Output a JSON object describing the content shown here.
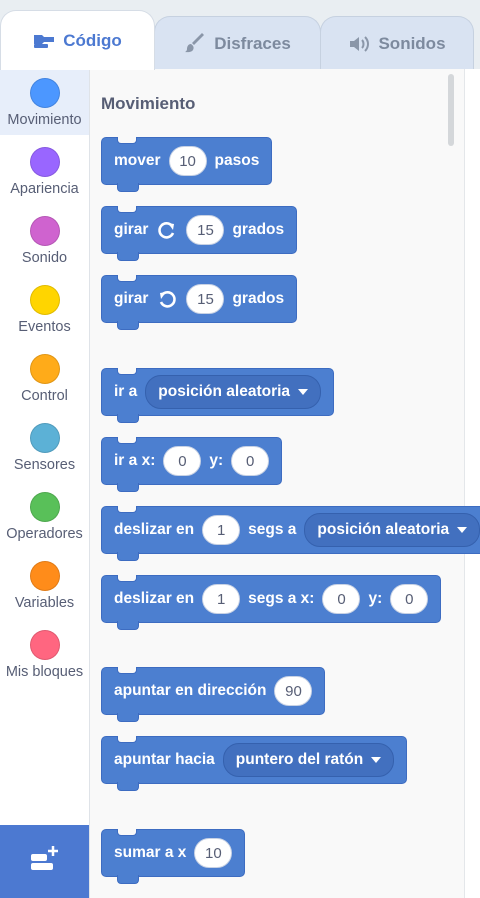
{
  "tabs": [
    {
      "label": "Código",
      "icon": "code-blocks-icon",
      "active": true
    },
    {
      "label": "Disfraces",
      "icon": "paintbrush-icon",
      "active": false
    },
    {
      "label": "Sonidos",
      "icon": "speaker-icon",
      "active": false
    }
  ],
  "categories": [
    {
      "label": "Movimiento",
      "color": "#4c97ff",
      "active": true
    },
    {
      "label": "Apariencia",
      "color": "#9966ff"
    },
    {
      "label": "Sonido",
      "color": "#cf63cf"
    },
    {
      "label": "Eventos",
      "color": "#ffd500"
    },
    {
      "label": "Control",
      "color": "#ffab19"
    },
    {
      "label": "Sensores",
      "color": "#5cb1d6"
    },
    {
      "label": "Operadores",
      "color": "#59c059"
    },
    {
      "label": "Variables",
      "color": "#ff8c1a"
    },
    {
      "label": "Mis bloques",
      "color": "#ff6680"
    }
  ],
  "extension_button": {
    "icon": "add-extension-icon"
  },
  "palette": {
    "section_title": "Movimiento",
    "blocks": {
      "move": {
        "t1": "mover",
        "v1": "10",
        "t2": "pasos"
      },
      "turn_right": {
        "t1": "girar",
        "v1": "15",
        "t2": "grados",
        "icon": "rotate-clockwise-icon"
      },
      "turn_left": {
        "t1": "girar",
        "v1": "15",
        "t2": "grados",
        "icon": "rotate-counterclockwise-icon"
      },
      "goto": {
        "t1": "ir a",
        "dropdown": "posición aleatoria"
      },
      "goto_xy": {
        "t1": "ir a x:",
        "v1": "0",
        "t2": "y:",
        "v2": "0"
      },
      "glide_to": {
        "t1": "deslizar en",
        "v1": "1",
        "t2": "segs a",
        "dropdown": "posición aleatoria"
      },
      "glide_xy": {
        "t1": "deslizar en",
        "v1": "1",
        "t2": "segs a x:",
        "v2": "0",
        "t3": "y:",
        "v3": "0"
      },
      "point_dir": {
        "t1": "apuntar en dirección",
        "v1": "90"
      },
      "point_towards": {
        "t1": "apuntar hacia",
        "dropdown": "puntero del ratón"
      },
      "change_x": {
        "t1": "sumar a x",
        "v1": "10"
      }
    }
  },
  "colors": {
    "accent": "#4c79d1",
    "motion_block": "#4c7fd0"
  }
}
